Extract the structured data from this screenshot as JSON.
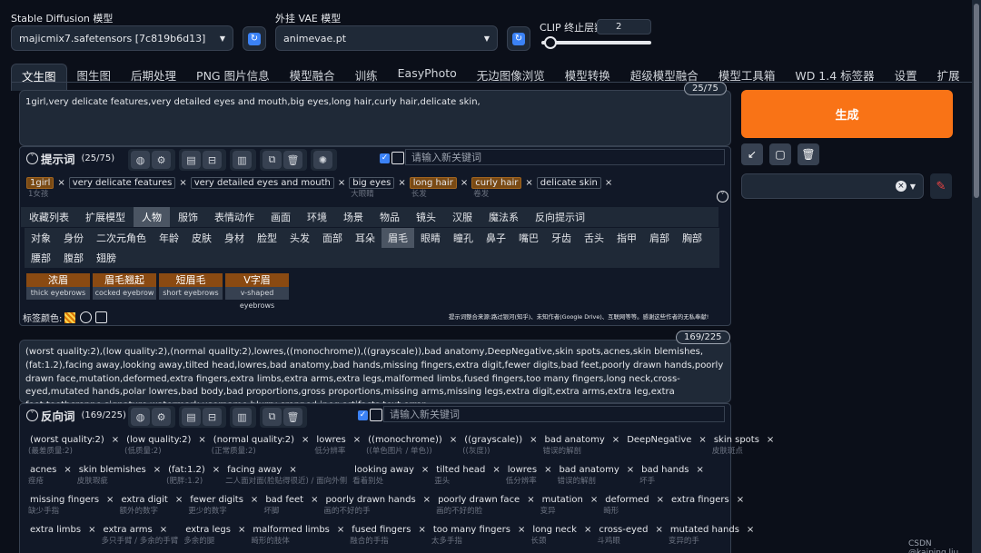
{
  "top": {
    "model_label": "Stable Diffusion 模型",
    "model_value": "majicmix7.safetensors [7c819b6d13]",
    "vae_label": "外挂 VAE 模型",
    "vae_value": "animevae.pt",
    "clip_label": "CLIP 终止层数",
    "clip_value": "2",
    "clip_level": 0.083
  },
  "tabs": [
    "文生图",
    "图生图",
    "后期处理",
    "PNG 图片信息",
    "模型融合",
    "训练",
    "EasyPhoto",
    "无边图像浏览",
    "模型转换",
    "超级模型融合",
    "模型工具箱",
    "WD 1.4 标签器",
    "设置",
    "扩展"
  ],
  "prompt": {
    "counter": "25/75",
    "text": "1girl,very delicate features,very detailed eyes and mouth,big eyes,long hair,curly hair,delicate skin,",
    "title": "提示词",
    "count": "(25/75)",
    "kw_placeholder": "请输入新关键词",
    "chips": [
      {
        "t": "1girl",
        "s": "1女孩",
        "or": true
      },
      {
        "t": "very delicate features",
        "s": ""
      },
      {
        "t": "very detailed eyes and mouth",
        "s": ""
      },
      {
        "t": "big eyes",
        "s": "大眼睛"
      },
      {
        "t": "long hair",
        "s": "长发",
        "or": true
      },
      {
        "t": "curly hair",
        "s": "卷发",
        "or": true
      },
      {
        "t": "delicate skin",
        "s": ""
      }
    ]
  },
  "categories": [
    "收藏列表",
    "扩展模型",
    "人物",
    "服饰",
    "表情动作",
    "画面",
    "环境",
    "场景",
    "物品",
    "镜头",
    "汉服",
    "魔法系",
    "反向提示词"
  ],
  "active_category": "人物",
  "subcats": [
    "对象",
    "身份",
    "二次元角色",
    "年龄",
    "皮肤",
    "身材",
    "脸型",
    "头发",
    "面部",
    "耳朵",
    "眉毛",
    "眼睛",
    "瞳孔",
    "鼻子",
    "嘴巴",
    "牙齿",
    "舌头",
    "指甲",
    "肩部",
    "胸部",
    "腰部",
    "腹部",
    "翅膀"
  ],
  "active_subcat": "眉毛",
  "options": [
    {
      "a": "浓眉",
      "b": "thick eyebrows"
    },
    {
      "a": "眉毛翘起",
      "b": "cocked eyebrow"
    },
    {
      "a": "短眉毛",
      "b": "short eyebrows"
    },
    {
      "a": "V字眉",
      "b": "v-shaped eyebrows"
    }
  ],
  "color_label": "标签颜色:",
  "source_note": "提示词整合来源:路过银河(知乎)、未知作者(Google Drive)、互联网等等。感谢这些作者的无私奉献!",
  "negative": {
    "counter": "169/225",
    "text": "(worst quality:2),(low quality:2),(normal quality:2),lowres,((monochrome)),((grayscale)),bad anatomy,DeepNegative,skin spots,acnes,skin blemishes,(fat:1.2),facing away,looking away,tilted head,lowres,bad anatomy,bad hands,missing fingers,extra digit,fewer digits,bad feet,poorly drawn hands,poorly drawn face,mutation,deformed,extra fingers,extra limbs,extra arms,extra legs,malformed limbs,fused fingers,too many fingers,long neck,cross-eyed,mutated hands,polar lowres,bad body,bad proportions,gross proportions,missing arms,missing legs,extra digit,extra arms,extra leg,extra foot,teethcroppe,signature,watermark,username,blurry,cropped,jpeg artifacts,text,error,",
    "title": "反向词",
    "count": "(169/225)",
    "kw_placeholder": "请输入新关键词",
    "rows": [
      [
        {
          "t": "(worst quality:2)",
          "s": "(最差质量:2)"
        },
        {
          "t": "(low quality:2)",
          "s": "(低质量:2)"
        },
        {
          "t": "(normal quality:2)",
          "s": "(正常质量:2)"
        },
        {
          "t": "lowres",
          "s": "低分辨率"
        },
        {
          "t": "((monochrome))",
          "s": "((单色图片 / 单色))"
        },
        {
          "t": "((grayscale))",
          "s": "((灰度))"
        },
        {
          "t": "bad anatomy",
          "s": "错误的解剖"
        },
        {
          "t": "DeepNegative",
          "s": ""
        },
        {
          "t": "skin spots",
          "s": "皮肤斑点"
        }
      ],
      [
        {
          "t": "acnes",
          "s": "痤疮"
        },
        {
          "t": "skin blemishes",
          "s": "皮肤瑕疵"
        },
        {
          "t": "(fat:1.2)",
          "s": "(肥胖:1.2)"
        },
        {
          "t": "facing away",
          "s": "二人面对面(脸贴得很近) / 面向外侧"
        },
        {
          "t": "looking away",
          "s": "看着别处"
        },
        {
          "t": "tilted head",
          "s": "歪头"
        },
        {
          "t": "lowres",
          "s": "低分辨率"
        },
        {
          "t": "bad anatomy",
          "s": "错误的解剖"
        },
        {
          "t": "bad hands",
          "s": "坏手"
        }
      ],
      [
        {
          "t": "missing fingers",
          "s": "缺少手指"
        },
        {
          "t": "extra digit",
          "s": "额外的数字"
        },
        {
          "t": "fewer digits",
          "s": "更少的数字"
        },
        {
          "t": "bad feet",
          "s": "坏脚"
        },
        {
          "t": "poorly drawn hands",
          "s": "画的不好的手"
        },
        {
          "t": "poorly drawn face",
          "s": "画的不好的脸"
        },
        {
          "t": "mutation",
          "s": "变异"
        },
        {
          "t": "deformed",
          "s": "畸形"
        },
        {
          "t": "extra fingers",
          "s": ""
        }
      ],
      [
        {
          "t": "extra limbs",
          "s": ""
        },
        {
          "t": "extra arms",
          "s": "多只手臂 / 多余的手臂"
        },
        {
          "t": "extra legs",
          "s": "多余的腿"
        },
        {
          "t": "malformed limbs",
          "s": "畸形的肢体"
        },
        {
          "t": "fused fingers",
          "s": "融合的手指"
        },
        {
          "t": "too many fingers",
          "s": "太多手指"
        },
        {
          "t": "long neck",
          "s": "长颈"
        },
        {
          "t": "cross-eyed",
          "s": "斗鸡眼"
        },
        {
          "t": "mutated hands",
          "s": "变异的手"
        }
      ]
    ]
  },
  "right": {
    "generate_label": "生成"
  },
  "watermark": "CSDN @kaiping.liu"
}
